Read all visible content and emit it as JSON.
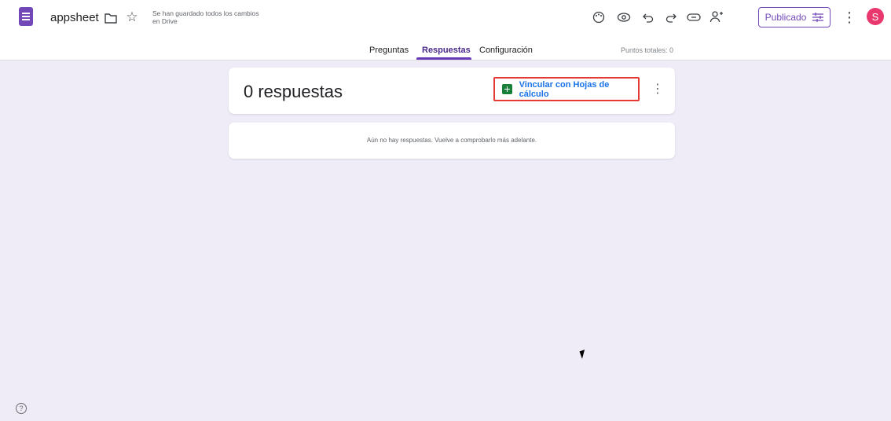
{
  "header": {
    "doc_title": "appsheet",
    "save_status": "Se han guardado todos los cambios en Drive",
    "publish_label": "Publicado",
    "avatar_letter": "S",
    "icons": {
      "folder": "📁",
      "star": "☆",
      "palette": "◍",
      "preview": "◎",
      "undo": "↶",
      "redo": "↷",
      "link": "⊖",
      "add_collaborator": "⚇",
      "publish_settings": "☷",
      "more": "⋮"
    }
  },
  "tabs": {
    "items": [
      "Preguntas",
      "Respuestas",
      "Configuración"
    ],
    "active": "Respuestas",
    "points_label": "Puntos totales: 0"
  },
  "responses": {
    "count_title": "0 respuestas",
    "sheets_button": "Vincular con Hojas de cálculo",
    "empty_message": "Aún no hay respuestas. Vuelve a comprobarlo más adelante."
  },
  "footer": {
    "help_icon": "?"
  },
  "colors": {
    "accent": "#673ab7",
    "publish": "#7248b9",
    "background": "#efecf8",
    "highlight": "#e53935",
    "sheets_green": "#188038",
    "link_blue": "#1a73e8"
  }
}
